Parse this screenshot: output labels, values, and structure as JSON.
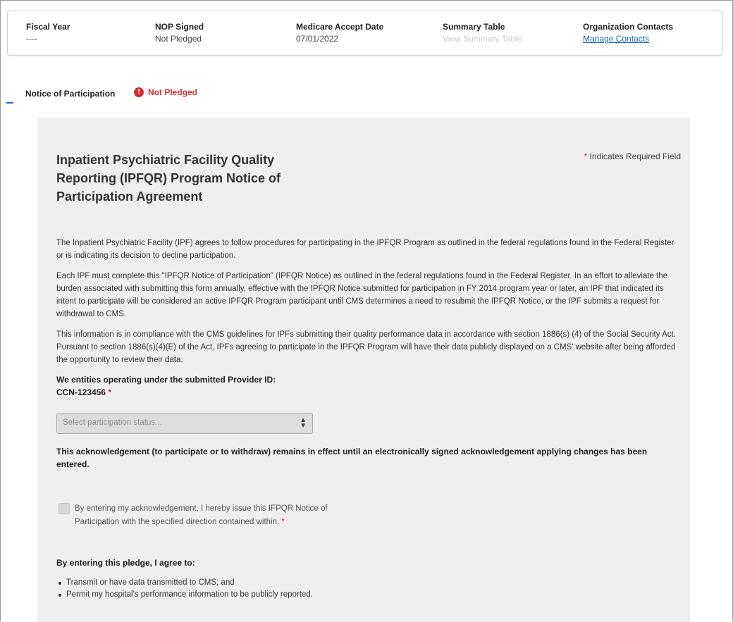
{
  "summary": {
    "fiscal_year": {
      "label": "Fiscal Year",
      "value": "----"
    },
    "nop_signed": {
      "label": "NOP Signed",
      "value": "Not Pledged"
    },
    "medicare_accept_date": {
      "label": "Medicare Accept Date",
      "value": "07/01/2022"
    },
    "summary_table": {
      "label": "Summary Table",
      "link": "View Summary Table"
    },
    "organization_contacts": {
      "label": "Organization Contacts",
      "link": "Manage Contacts"
    }
  },
  "notice": {
    "heading": "Notice of Participation",
    "status": "Not Pledged",
    "status_icon": "alert-circle-icon",
    "status_color": "#d32f2f"
  },
  "form": {
    "title": "Inpatient Psychiatric Facility Quality Reporting (IPFQR) Program Notice of Participation Agreement",
    "required_star": "*",
    "required_note": "Indicates Required Field",
    "paragraphs": [
      "The Inpatient Psychiatric Facility (IPF) agrees to follow procedures for participating in the IPFQR Program as outlined in the federal regulations found in the Federal Register or is indicating its decision to decline participation.",
      "Each IPF must complete this \"IPFQR Notice of Participation\" (IPFQR Notice) as outlined in the federal regulations found in the Federal Register. In an effort to alleviate the burden associated with submitting this form annually, effective with the IPFQR Notice submitted for participation in FY 2014 program year or later, an IPF that indicated its intent to participate will be considered an active IPFQR Program participant until CMS determines a need to resubmit the IPFQR Notice, or the IPF submits a request for withdrawal to CMS.",
      "This information is in compliance with the CMS guidelines for IPFs submitting their quality performance data in accordance with section 1886(s) (4) of the Social Security Act. Pursuant to section 1886(s)(4)(E) of the Act, IPFs agreeing to participate in the IPFQR Program will have their data publicly displayed on a CMS' website after being afforded the opportunity to review their data."
    ],
    "entities_label": "We entities operating under the submitted Provider ID:",
    "ccn": "CCN-123456",
    "ccn_star": "*",
    "select_placeholder": "Select participation status...",
    "acknowledgement_note": "This acknowledgement (to participate or to withdraw) remains in effect until an electronically signed acknowledgement applying changes has been entered.",
    "checkbox_label": "By entering my acknowledgement, I hereby issue this IFPQR Notice of Participation with the specified direction contained within.",
    "checkbox_star": "*",
    "agree_heading": "By entering this pledge, I agree to:",
    "agree_items": [
      "Transmit or have data transmitted to CMS; and",
      "Permit my hospital's performance information to be publicly reported."
    ]
  }
}
